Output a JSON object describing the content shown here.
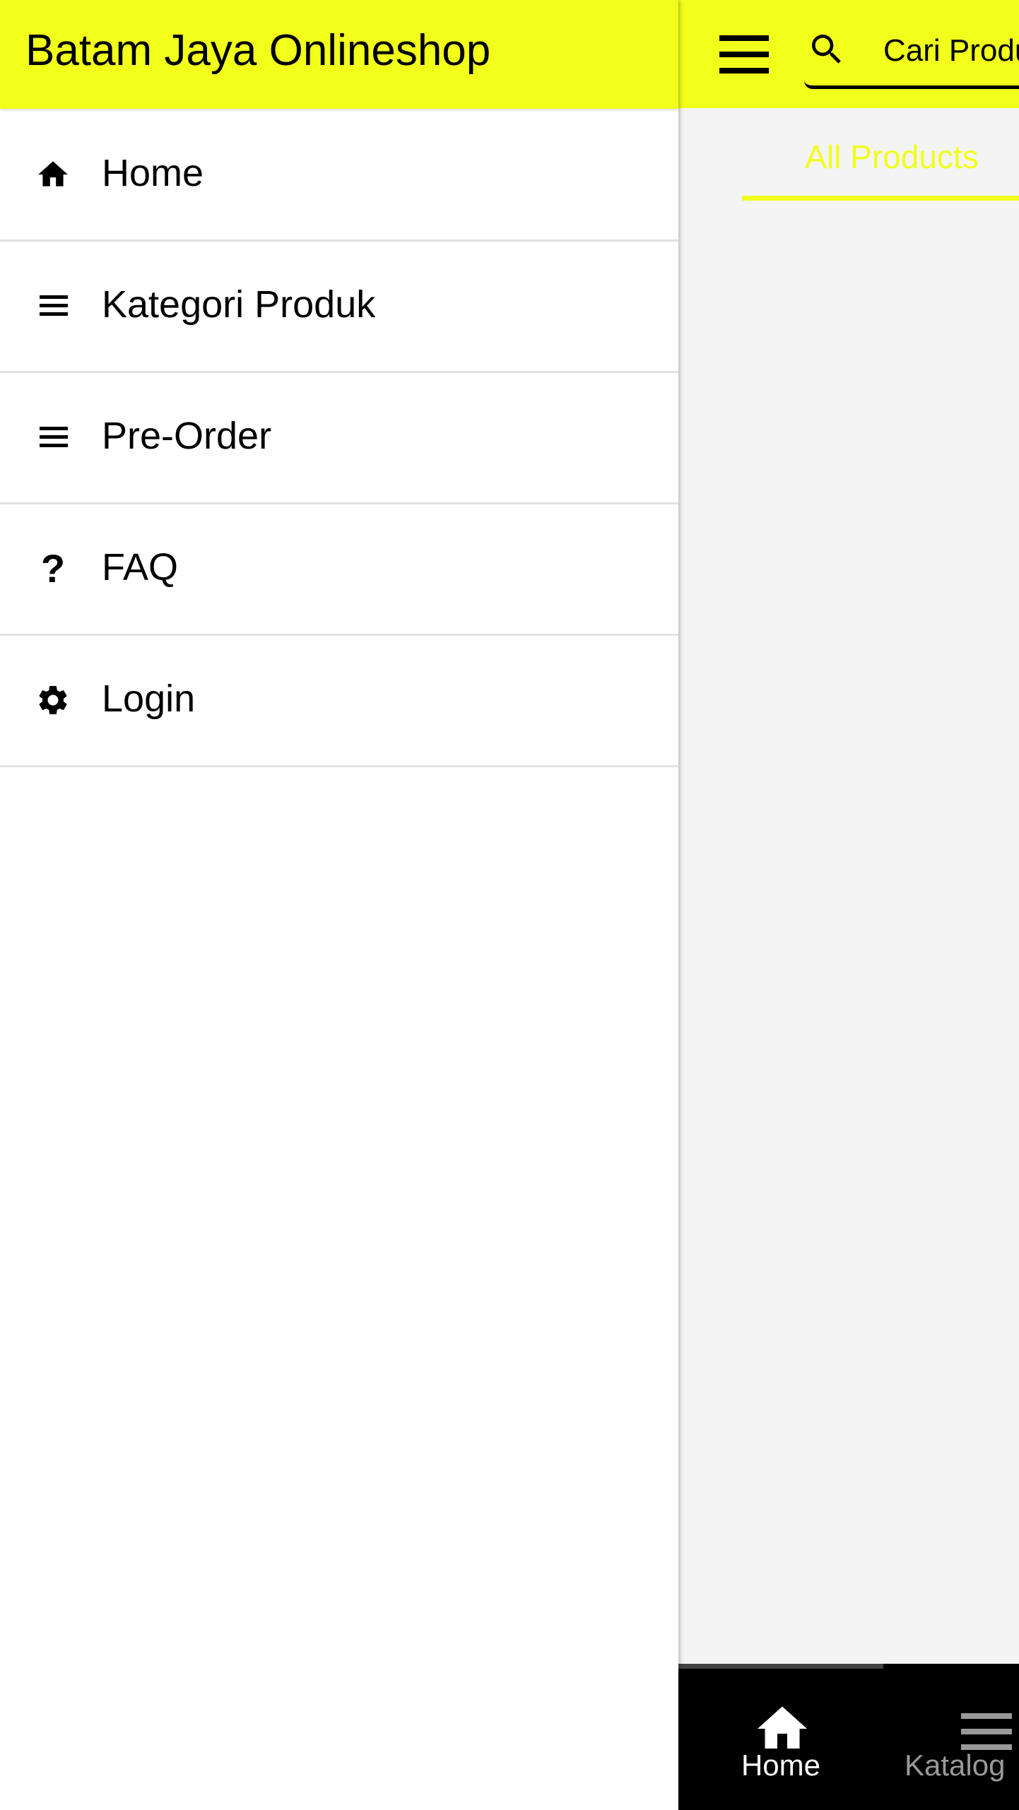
{
  "app": {
    "title": "Batam Jaya Onlineshop",
    "accent_color": "#f1ff1b"
  },
  "header": {
    "menu_icon": "hamburger-icon",
    "search": {
      "icon": "search-icon",
      "placeholder": "Cari Produk",
      "value": ""
    }
  },
  "tabs": [
    {
      "label": "All Products",
      "active": true
    }
  ],
  "drawer": {
    "title": "Batam Jaya Onlineshop",
    "items": [
      {
        "label": "Home",
        "icon": "home-icon"
      },
      {
        "label": "Kategori Produk",
        "icon": "list-icon"
      },
      {
        "label": "Pre-Order",
        "icon": "list-icon"
      },
      {
        "label": "FAQ",
        "icon": "question-icon"
      },
      {
        "label": "Login",
        "icon": "gear-icon"
      }
    ]
  },
  "bottom_nav": {
    "items": [
      {
        "label": "Home",
        "icon": "home-icon",
        "active": true
      },
      {
        "label": "Katalog",
        "icon": "list-icon",
        "active": false
      }
    ]
  }
}
